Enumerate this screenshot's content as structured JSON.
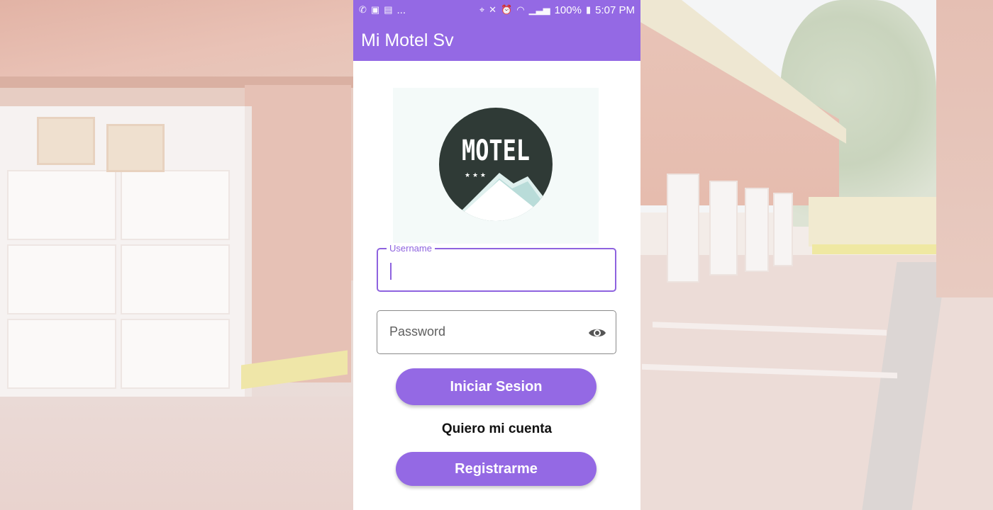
{
  "status_bar": {
    "left_icons": [
      "whatsapp-icon",
      "image-icon",
      "gallery-icon"
    ],
    "more": "...",
    "right_icons": [
      "location-icon",
      "mute-icon",
      "alarm-icon",
      "wifi-icon",
      "signal-icon"
    ],
    "battery": "100%",
    "time": "5:07 PM"
  },
  "app_bar": {
    "title": "Mi Motel Sv"
  },
  "logo": {
    "text": "MOTEL",
    "stars": "★ ★ ★"
  },
  "login_form": {
    "username_label": "Username",
    "password_placeholder": "Password",
    "password_toggle_icon": "eye-icon",
    "login_button": "Iniciar Sesion",
    "account_link": "Quiero mi cuenta",
    "register_button": "Registrarme"
  },
  "colors": {
    "primary": "#9469e4",
    "logo_dark": "#2f3a36",
    "logo_mountain": "#cfe7e5"
  }
}
